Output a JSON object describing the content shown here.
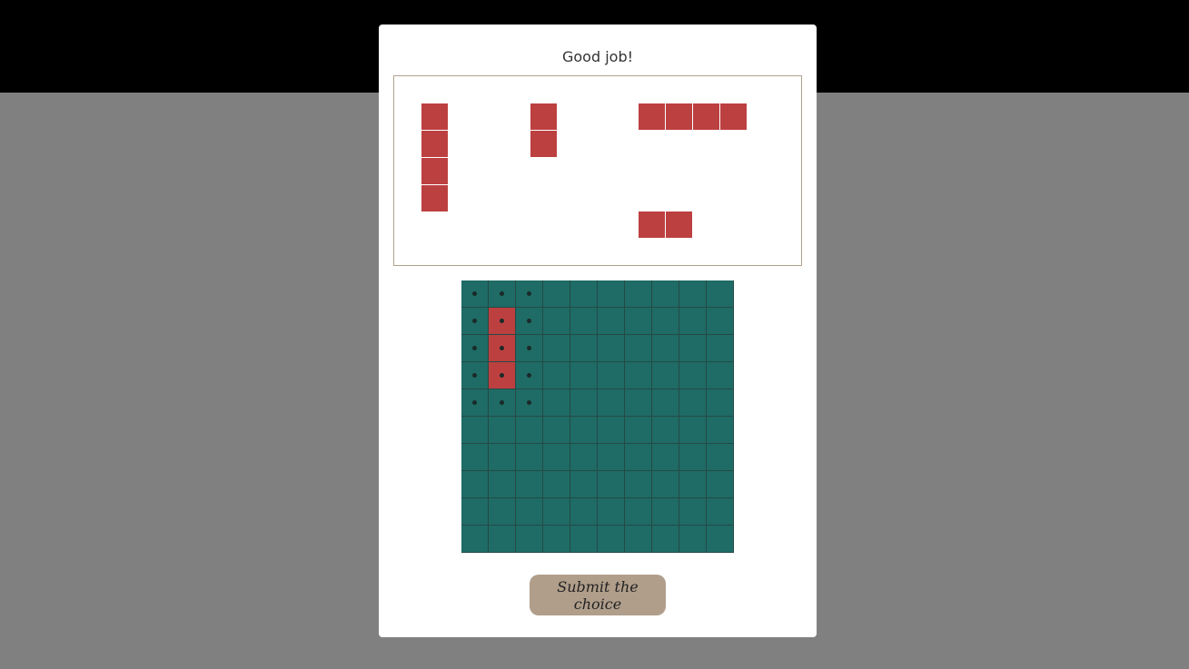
{
  "header": {
    "message": "Good job!"
  },
  "pieces": [
    {
      "name": "piece-vertical-4",
      "cells": [
        [
          0,
          0
        ],
        [
          0,
          1
        ],
        [
          0,
          2
        ],
        [
          0,
          3
        ]
      ]
    },
    {
      "name": "piece-vertical-2",
      "cells": [
        [
          0,
          0
        ],
        [
          0,
          1
        ]
      ]
    },
    {
      "name": "piece-horizontal-4",
      "cells": [
        [
          0,
          0
        ],
        [
          1,
          0
        ],
        [
          2,
          0
        ],
        [
          3,
          0
        ]
      ]
    },
    {
      "name": "piece-horizontal-2",
      "cells": [
        [
          0,
          0
        ],
        [
          1,
          0
        ]
      ]
    }
  ],
  "board": {
    "rows": 10,
    "cols": 10,
    "filled": [
      [
        1,
        1
      ],
      [
        2,
        1
      ],
      [
        3,
        1
      ]
    ],
    "dotted": [
      [
        0,
        0
      ],
      [
        0,
        1
      ],
      [
        0,
        2
      ],
      [
        1,
        0
      ],
      [
        1,
        1
      ],
      [
        1,
        2
      ],
      [
        2,
        0
      ],
      [
        2,
        1
      ],
      [
        2,
        2
      ],
      [
        3,
        0
      ],
      [
        3,
        1
      ],
      [
        3,
        2
      ],
      [
        4,
        0
      ],
      [
        4,
        1
      ],
      [
        4,
        2
      ]
    ]
  },
  "actions": {
    "submit_label": "Submit the choice"
  },
  "colors": {
    "piece": "#bd4040",
    "board": "#1f6b65",
    "button": "#b09e8b"
  }
}
